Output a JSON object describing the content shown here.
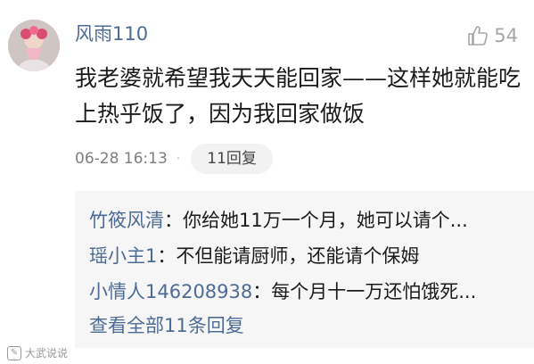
{
  "comment": {
    "username": "风雨110",
    "like_count": "54",
    "text": "我老婆就希望我天天能回家——这样她就能吃上热乎饭了，因为我回家做饭",
    "timestamp": "06-28 16:13",
    "separator": "·",
    "reply_button": "11回复"
  },
  "replies": [
    {
      "author": "竹筱风清",
      "sep": "：",
      "text": "你给她11万一个月，她可以请个..."
    },
    {
      "author": "瑶小主1",
      "sep": "：",
      "text": "不但能请厨师，还能请个保姆"
    },
    {
      "author": "小情人146208938",
      "sep": "：",
      "text": "每个月十一万还怕饿死..."
    }
  ],
  "view_all": "查看全部11条回复",
  "watermark": "大武说说",
  "icons": {
    "like": "thumbs-up-icon",
    "avatar": "user-avatar"
  },
  "colors": {
    "link": "#4e6b96",
    "text": "#1b1b1b",
    "muted": "#7d7d7d",
    "reply_bg": "#f6f6f6"
  }
}
